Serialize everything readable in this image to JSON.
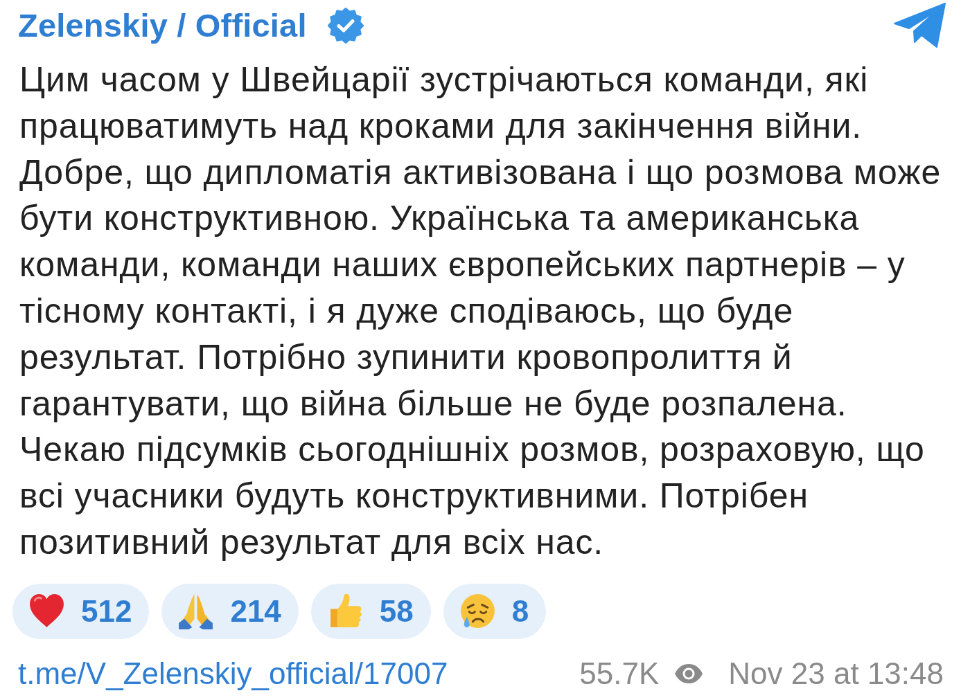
{
  "channel": {
    "name": "Zelenskiy / Official",
    "verified": true
  },
  "post": {
    "text": "Цим часом у Швейцарії зустрічаються команди, які працюватимуть над кроками для закінчення війни. Добре, що дипломатія активізована і що розмова може бути конструктивною. Українська та американська команди, команди наших європейських партнерів – у тісному контакті, і я дуже сподіваюсь, що буде результат. Потрібно зупинити кровопролиття й гарантувати, що війна більше не буде розпалена. Чекаю підсумків сьогоднішніх розмов, розраховую, що всі учасники будуть конструктивними. Потрібен позитивний результат для всіх нас."
  },
  "reactions": [
    {
      "kind": "heart",
      "count": "512"
    },
    {
      "kind": "pray",
      "count": "214"
    },
    {
      "kind": "thumbs_up",
      "count": "58"
    },
    {
      "kind": "cry",
      "count": "8"
    }
  ],
  "footer": {
    "link": "t.me/V_Zelenskiy_official/17007",
    "views": "55.7K",
    "date": "Nov 23 at 13:48"
  }
}
